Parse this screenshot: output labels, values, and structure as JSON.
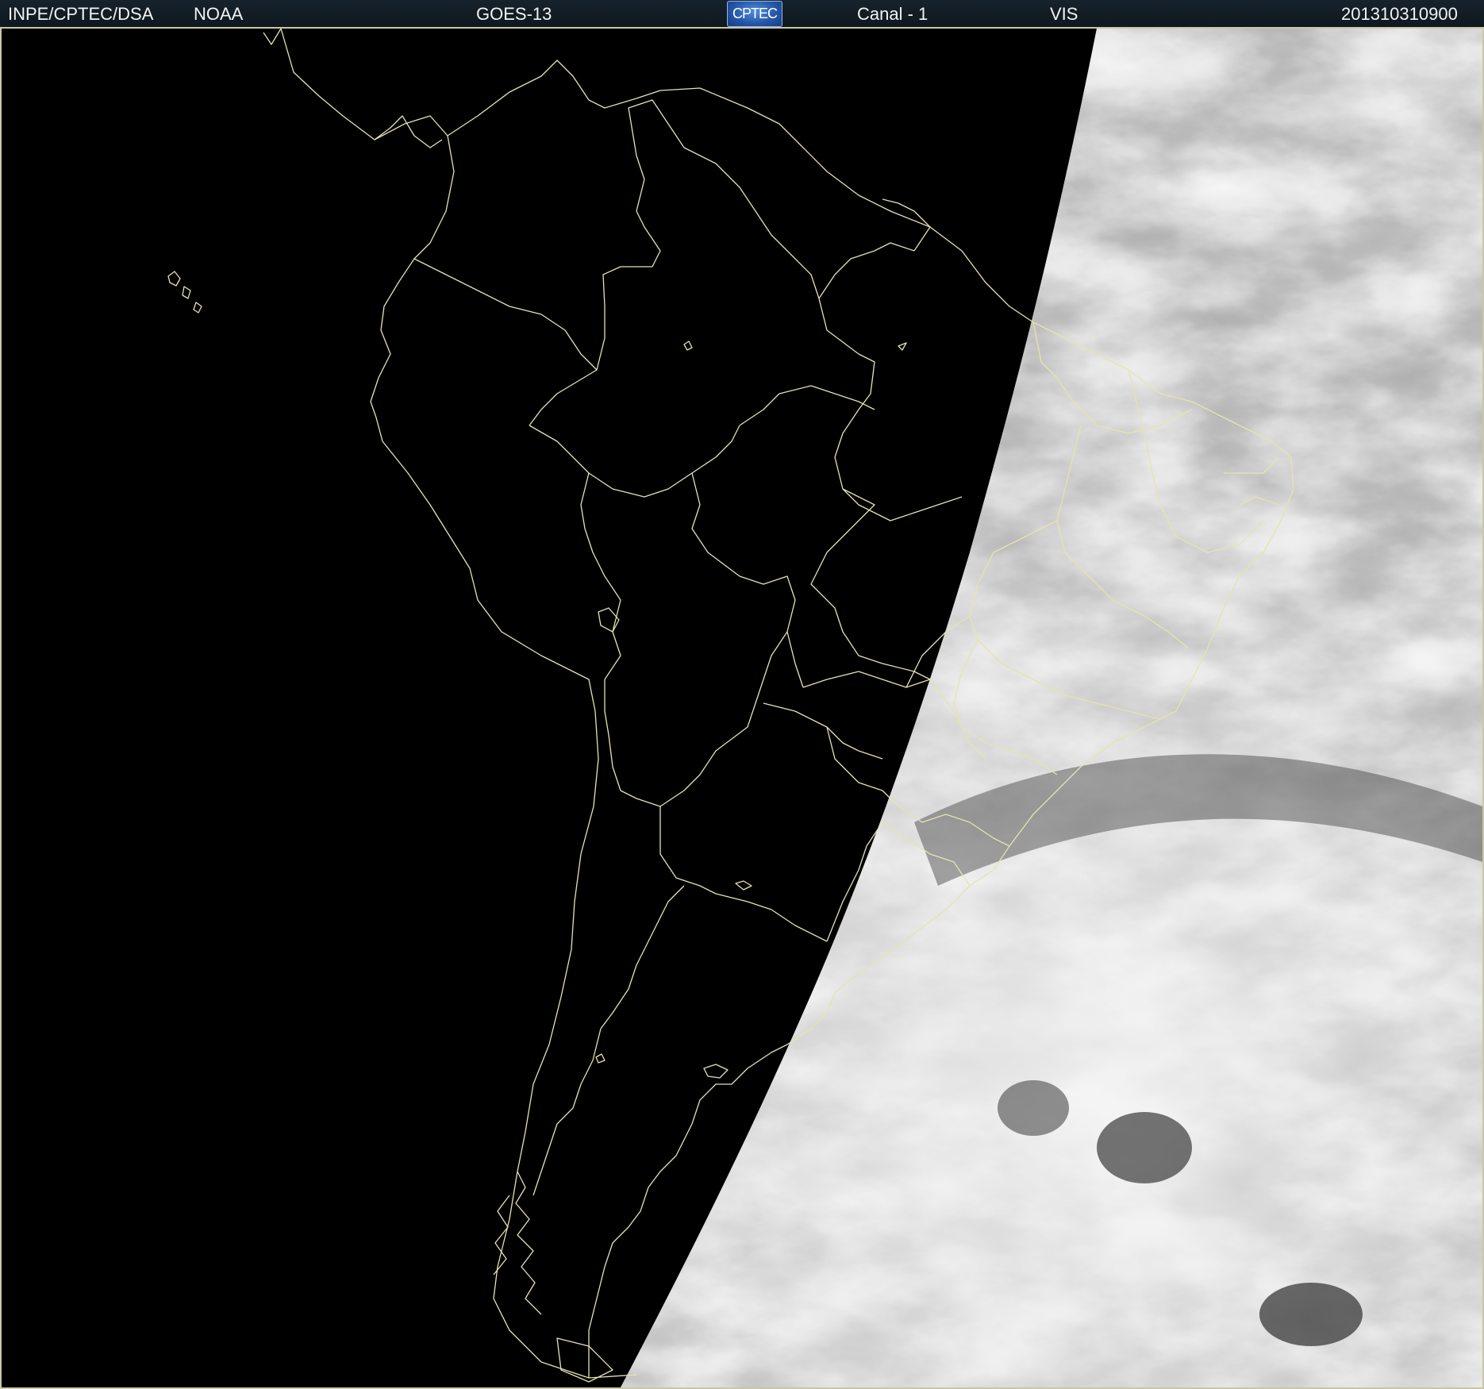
{
  "header": {
    "agency": "INPE/CPTEC/DSA",
    "source": "NOAA",
    "satellite": "GOES-13",
    "logo_text": "CPTEC",
    "channel": "Canal - 1",
    "band": "VIS",
    "timestamp": "201310310900"
  },
  "map": {
    "region": "South America",
    "night_color": "#000000",
    "boundary_color": "#e6e3b0",
    "cloud_color": "#e8e8e8",
    "ocean_color": "#8a8a8a"
  }
}
